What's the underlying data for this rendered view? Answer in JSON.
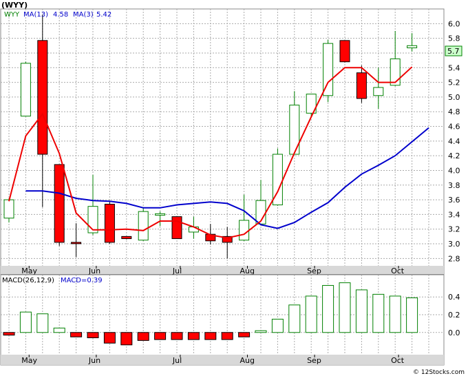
{
  "chart_data": [
    {
      "type": "candlestick",
      "title": "(WYY)",
      "symbol": "WYY",
      "legend": [
        {
          "text": "WYY",
          "color": "#008000"
        },
        {
          "text": "MA(13)",
          "color": "#0000cc"
        },
        {
          "text": "4.58",
          "color": "#0000cc"
        },
        {
          "text": "MA(3)",
          "color": "#0000cc"
        },
        {
          "text": "5.42",
          "color": "#0000cc"
        }
      ],
      "last_price_label": "5.7",
      "ylim": [
        2.7,
        6.2
      ],
      "yticks": [
        "2.8",
        "3.0",
        "3.2",
        "3.4",
        "3.6",
        "3.8",
        "4.0",
        "4.2",
        "4.4",
        "4.6",
        "4.8",
        "5.0",
        "5.2",
        "5.4",
        "5.6",
        "5.8",
        "6.0"
      ],
      "xlabels": [
        "May",
        "Jun",
        "Jul",
        "Aug",
        "Sep",
        "Oct"
      ],
      "xlabel_weeks": [
        1.2,
        5.2,
        10.2,
        14.2,
        18.2,
        23.2
      ],
      "grid": true,
      "colors": {
        "up": "#008000",
        "down": "#ff0000",
        "ma13": "#0000cc",
        "ma3": "#ee0000",
        "price_label_bg": "#ccffcc",
        "grid": "#aaaaaa",
        "xaxis_band": "#d8d8d8"
      },
      "candles": [
        {
          "o": 3.35,
          "h": 3.62,
          "l": 3.29,
          "c": 3.6
        },
        {
          "o": 4.74,
          "h": 5.48,
          "l": 4.74,
          "c": 5.46
        },
        {
          "o": 5.77,
          "h": 6.12,
          "l": 3.5,
          "c": 4.22
        },
        {
          "o": 4.08,
          "h": 4.08,
          "l": 2.97,
          "c": 3.02
        },
        {
          "o": 3.02,
          "h": 3.28,
          "l": 2.82,
          "c": 3.01
        },
        {
          "o": 3.15,
          "h": 3.94,
          "l": 3.12,
          "c": 3.51
        },
        {
          "o": 3.54,
          "h": 3.57,
          "l": 3.0,
          "c": 3.02
        },
        {
          "o": 3.1,
          "h": 3.1,
          "l": 3.06,
          "c": 3.07
        },
        {
          "o": 3.05,
          "h": 3.5,
          "l": 3.04,
          "c": 3.44
        },
        {
          "o": 3.39,
          "h": 3.44,
          "l": 3.24,
          "c": 3.41
        },
        {
          "o": 3.37,
          "h": 3.37,
          "l": 3.08,
          "c": 3.07
        },
        {
          "o": 3.16,
          "h": 3.37,
          "l": 3.07,
          "c": 3.23
        },
        {
          "o": 3.13,
          "h": 3.27,
          "l": 2.99,
          "c": 3.04
        },
        {
          "o": 3.1,
          "h": 3.23,
          "l": 2.8,
          "c": 3.02
        },
        {
          "o": 3.05,
          "h": 3.67,
          "l": 3.04,
          "c": 3.32
        },
        {
          "o": 3.27,
          "h": 3.87,
          "l": 3.25,
          "c": 3.59
        },
        {
          "o": 3.53,
          "h": 4.3,
          "l": 3.52,
          "c": 4.22
        },
        {
          "o": 4.22,
          "h": 5.08,
          "l": 4.22,
          "c": 4.89
        },
        {
          "o": 4.78,
          "h": 5.04,
          "l": 4.74,
          "c": 5.04
        },
        {
          "o": 5.02,
          "h": 5.78,
          "l": 4.93,
          "c": 5.73
        },
        {
          "o": 5.77,
          "h": 5.77,
          "l": 5.47,
          "c": 5.48
        },
        {
          "o": 5.33,
          "h": 5.43,
          "l": 4.92,
          "c": 4.98
        },
        {
          "o": 5.02,
          "h": 5.4,
          "l": 4.84,
          "c": 5.13
        },
        {
          "o": 5.16,
          "h": 5.9,
          "l": 5.15,
          "c": 5.52
        },
        {
          "o": 5.67,
          "h": 5.87,
          "l": 5.62,
          "c": 5.7
        }
      ],
      "ma13": [
        {
          "w": 1,
          "v": 3.72
        },
        {
          "w": 2,
          "v": 3.72
        },
        {
          "w": 3,
          "v": 3.69
        },
        {
          "w": 4,
          "v": 3.62
        },
        {
          "w": 5,
          "v": 3.59
        },
        {
          "w": 6,
          "v": 3.58
        },
        {
          "w": 7,
          "v": 3.55
        },
        {
          "w": 8,
          "v": 3.49
        },
        {
          "w": 9,
          "v": 3.49
        },
        {
          "w": 10,
          "v": 3.53
        },
        {
          "w": 11,
          "v": 3.55
        },
        {
          "w": 12,
          "v": 3.57
        },
        {
          "w": 13,
          "v": 3.55
        },
        {
          "w": 14,
          "v": 3.45
        },
        {
          "w": 15,
          "v": 3.26
        },
        {
          "w": 16,
          "v": 3.21
        },
        {
          "w": 17,
          "v": 3.29
        },
        {
          "w": 18,
          "v": 3.43
        },
        {
          "w": 19,
          "v": 3.56
        },
        {
          "w": 20,
          "v": 3.77
        },
        {
          "w": 21,
          "v": 3.95
        },
        {
          "w": 22,
          "v": 4.07
        },
        {
          "w": 23,
          "v": 4.2
        },
        {
          "w": 24,
          "v": 4.39
        },
        {
          "w": 25,
          "v": 4.58
        }
      ],
      "ma3": [
        {
          "w": 0,
          "v": 3.58
        },
        {
          "w": 1,
          "v": 4.47
        },
        {
          "w": 2,
          "v": 4.77
        },
        {
          "w": 3,
          "v": 4.23
        },
        {
          "w": 4,
          "v": 3.42
        },
        {
          "w": 5,
          "v": 3.19
        },
        {
          "w": 6,
          "v": 3.19
        },
        {
          "w": 7,
          "v": 3.2
        },
        {
          "w": 8,
          "v": 3.18
        },
        {
          "w": 9,
          "v": 3.31
        },
        {
          "w": 10,
          "v": 3.31
        },
        {
          "w": 11,
          "v": 3.23
        },
        {
          "w": 12,
          "v": 3.12
        },
        {
          "w": 13,
          "v": 3.08
        },
        {
          "w": 14,
          "v": 3.13
        },
        {
          "w": 15,
          "v": 3.31
        },
        {
          "w": 16,
          "v": 3.71
        },
        {
          "w": 17,
          "v": 4.24
        },
        {
          "w": 18,
          "v": 4.73
        },
        {
          "w": 19,
          "v": 5.2
        },
        {
          "w": 20,
          "v": 5.4
        },
        {
          "w": 21,
          "v": 5.4
        },
        {
          "w": 22,
          "v": 5.2
        },
        {
          "w": 23,
          "v": 5.2
        },
        {
          "w": 24,
          "v": 5.41
        }
      ]
    },
    {
      "type": "bar",
      "title": "MACD(26,12,9)",
      "legend": [
        {
          "text": "MACD(26,12,9)",
          "color": "#000000"
        },
        {
          "text": "MACD=0.39",
          "color": "#0000cc"
        }
      ],
      "ylim": [
        -0.25,
        0.65
      ],
      "yticks": [
        "0.0",
        "0.2",
        "0.4"
      ],
      "xlabels": [
        "May",
        "Jun",
        "Jul",
        "Aug",
        "Sep",
        "Oct"
      ],
      "values": [
        -0.03,
        0.23,
        0.21,
        0.05,
        -0.05,
        -0.06,
        -0.12,
        -0.14,
        -0.09,
        -0.08,
        -0.08,
        -0.08,
        -0.08,
        -0.08,
        -0.05,
        0.02,
        0.15,
        0.31,
        0.41,
        0.53,
        0.56,
        0.48,
        0.43,
        0.41,
        0.39
      ]
    }
  ],
  "footer": {
    "watermark": "© 12Stocks.com"
  }
}
